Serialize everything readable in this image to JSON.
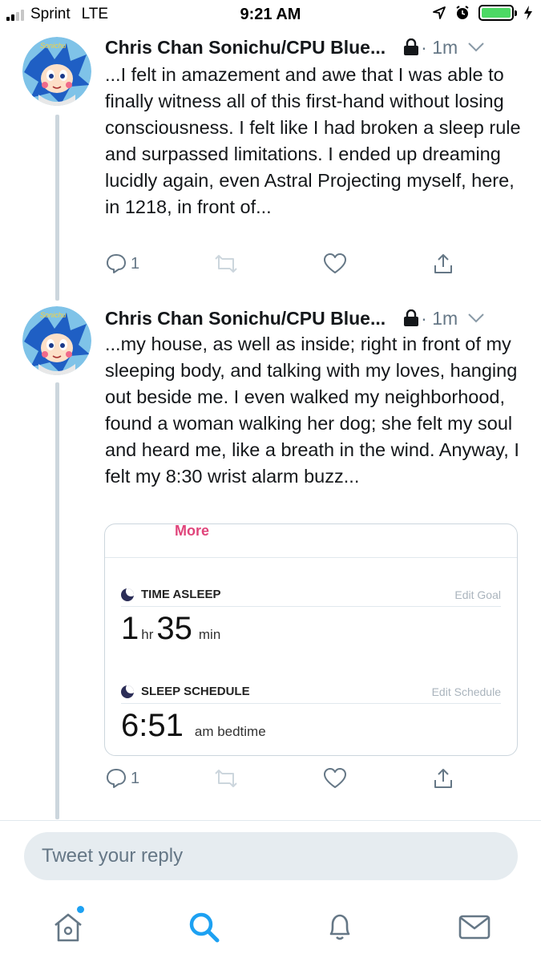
{
  "status_bar": {
    "carrier": "Sprint",
    "network": "LTE",
    "time": "9:21 AM",
    "battery_level": 1.0,
    "battery_color": "#4cd964"
  },
  "thread": [
    {
      "author": "Chris Chan Sonichu/CPU Blue...",
      "age": "· 1m",
      "text": "...I felt in amazement and awe that I was able to finally witness all of this first-hand without losing consciousness. I felt like I had broken a sleep rule and surpassed limitations. I ended up dreaming lucidly again, even Astral Projecting myself, here, in 1218, in front of...",
      "reply_count": "1",
      "avatar_text": "Sonichu"
    },
    {
      "author": "Chris Chan Sonichu/CPU Blue...",
      "age": "· 1m",
      "text": "...my house, as well as inside; right in front of my sleeping body, and talking with my loves, hanging out beside me. I even walked my neighborhood, found a woman walking her dog; she felt my soul and heard me, like a breath in the wind. Anyway, I felt my 8:30 wrist alarm buzz...",
      "reply_count": "1",
      "avatar_text": "Sonichu"
    }
  ],
  "sleep_card": {
    "more_label": "More",
    "time_asleep": {
      "title": "TIME ASLEEP",
      "edit_label": "Edit Goal",
      "hours": "1",
      "hours_unit": "hr",
      "minutes": "35",
      "minutes_unit": "min"
    },
    "sleep_schedule": {
      "title": "SLEEP SCHEDULE",
      "edit_label": "Edit Schedule",
      "time": "6:51",
      "caption": "am bedtime"
    }
  },
  "reply": {
    "placeholder": "Tweet your reply"
  },
  "tab_bar": {
    "items": [
      "home-icon",
      "search-icon",
      "notifications-icon",
      "messages-icon"
    ],
    "active": "search-icon",
    "accent": "#1da1f2"
  },
  "colors": {
    "accent": "#1da1f2",
    "muted": "#657786",
    "link_pink": "#e0457b"
  }
}
